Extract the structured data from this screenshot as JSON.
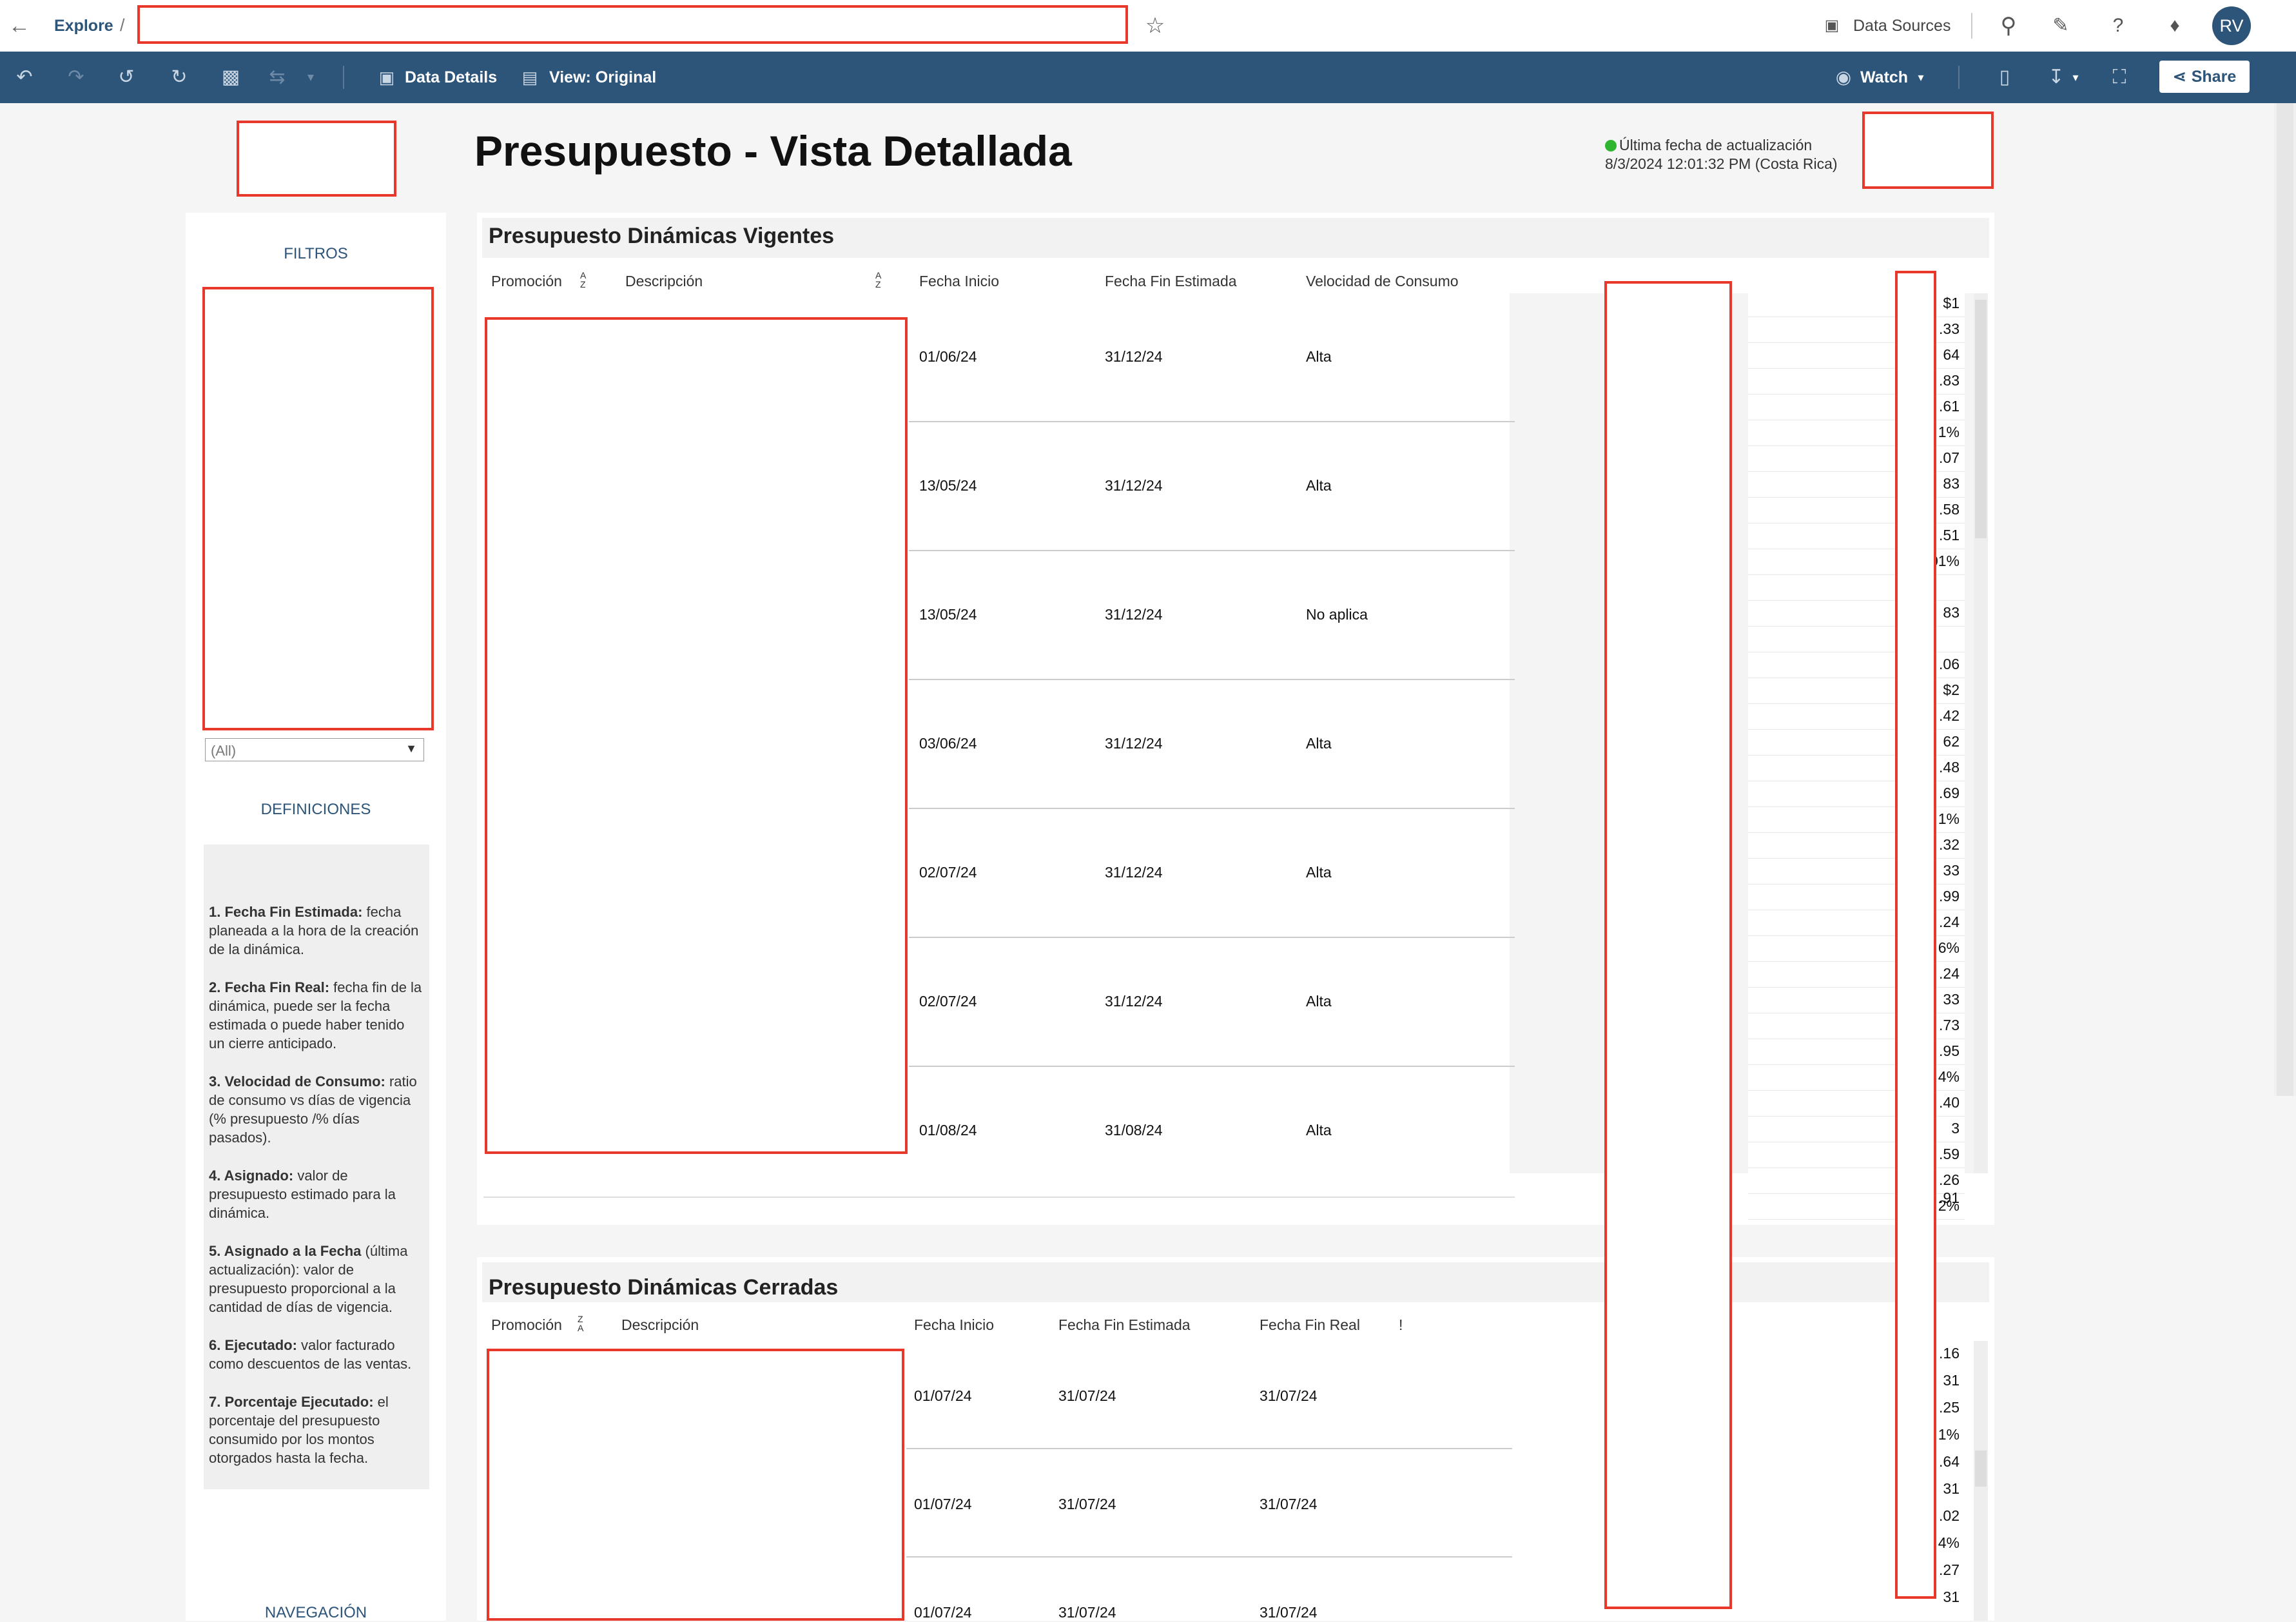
{
  "topbar": {
    "back_label": "←",
    "breadcrumb": "Explore",
    "separator": "/",
    "data_sources": "Data Sources",
    "avatar": "RV"
  },
  "toolbar": {
    "data_details": "Data Details",
    "view_original": "View: Original",
    "watch": "Watch",
    "share": "Share"
  },
  "header": {
    "title": "Presupuesto - Vista Detallada",
    "update_label": "Última fecha de actualización",
    "update_value": "8/3/2024 12:01:32 PM (Costa Rica)"
  },
  "sidebar": {
    "filters_title": "FILTROS",
    "filter_select": "(All)",
    "definitions_title": "DEFINICIONES",
    "definitions": [
      {
        "term": "1. Fecha Fin Estimada:",
        "text": " fecha planeada a la hora de la creación de la dinámica."
      },
      {
        "term": "2. Fecha Fin Real:",
        "text": " fecha fin de la dinámica, puede ser la fecha estimada o puede haber tenido un cierre anticipado."
      },
      {
        "term": "3. Velocidad de Consumo:",
        "text": " ratio de consumo vs días de vigencia (% presupuesto /% días pasados)."
      },
      {
        "term": "4.  Asignado:",
        "text": "  valor de presupuesto estimado para la dinámica."
      },
      {
        "term": "5. Asignado a la Fecha",
        "text": " (última actualización): valor de presupuesto proporcional a la cantidad de días de vigencia."
      },
      {
        "term": "6.  Ejecutado:",
        "text": " valor facturado como descuentos de las ventas."
      },
      {
        "term": "7. Porcentaje Ejecutado:",
        "text": " el porcentaje del presupuesto consumido por los montos otorgados hasta la fecha."
      }
    ],
    "nav_title": "NAVEGACIÓN"
  },
  "vigentes": {
    "title": "Presupuesto Dinámicas Vigentes",
    "headers": [
      "Promoción",
      "Descripción",
      "Fecha Inicio",
      "Fecha Fin Estimada",
      "Velocidad de  Consumo"
    ],
    "rows": [
      {
        "inicio": "01/06/24",
        "fin": "31/12/24",
        "vel": "Alta",
        "vals": [
          "$1",
          ".33",
          "64",
          ".83",
          ".61",
          "1%"
        ]
      },
      {
        "inicio": "13/05/24",
        "fin": "31/12/24",
        "vel": "Alta",
        "vals": [
          "",
          ".07",
          "83",
          ".58",
          ".51",
          "01%"
        ]
      },
      {
        "inicio": "13/05/24",
        "fin": "31/12/24",
        "vel": "No aplica",
        "vals": [
          "",
          "",
          "83",
          "",
          ".06",
          ""
        ]
      },
      {
        "inicio": "03/06/24",
        "fin": "31/12/24",
        "vel": "Alta",
        "vals": [
          "$2",
          ".42",
          "62",
          ".48",
          ".69",
          "1%"
        ]
      },
      {
        "inicio": "02/07/24",
        "fin": "31/12/24",
        "vel": "Alta",
        "vals": [
          "",
          ".32",
          "33",
          ".99",
          ".24",
          "6%"
        ]
      },
      {
        "inicio": "02/07/24",
        "fin": "31/12/24",
        "vel": "Alta",
        "vals": [
          "",
          ".24",
          "33",
          ".73",
          ".95",
          "4%"
        ]
      },
      {
        "inicio": "01/08/24",
        "fin": "31/08/24",
        "vel": "Alta",
        "vals": [
          "",
          ".40",
          "3",
          ".59",
          ".26",
          "2%"
        ]
      }
    ],
    "trailing": ".91"
  },
  "cerradas": {
    "title": "Presupuesto Dinámicas Cerradas",
    "headers": [
      "Promoción",
      "Descripción",
      "Fecha Inicio",
      "Fecha Fin Estimada",
      "Fecha Fin Real",
      "!"
    ],
    "rows": [
      {
        "inicio": "01/07/24",
        "fin_est": "31/07/24",
        "fin_real": "31/07/24",
        "vals": [
          ".16",
          "31",
          ".25",
          "1%"
        ]
      },
      {
        "inicio": "01/07/24",
        "fin_est": "31/07/24",
        "fin_real": "31/07/24",
        "vals": [
          ".64",
          "31",
          ".02",
          "4%"
        ]
      },
      {
        "inicio": "01/07/24",
        "fin_est": "31/07/24",
        "fin_real": "31/07/24",
        "vals": [
          ".27",
          "31",
          "",
          ""
        ]
      }
    ]
  }
}
